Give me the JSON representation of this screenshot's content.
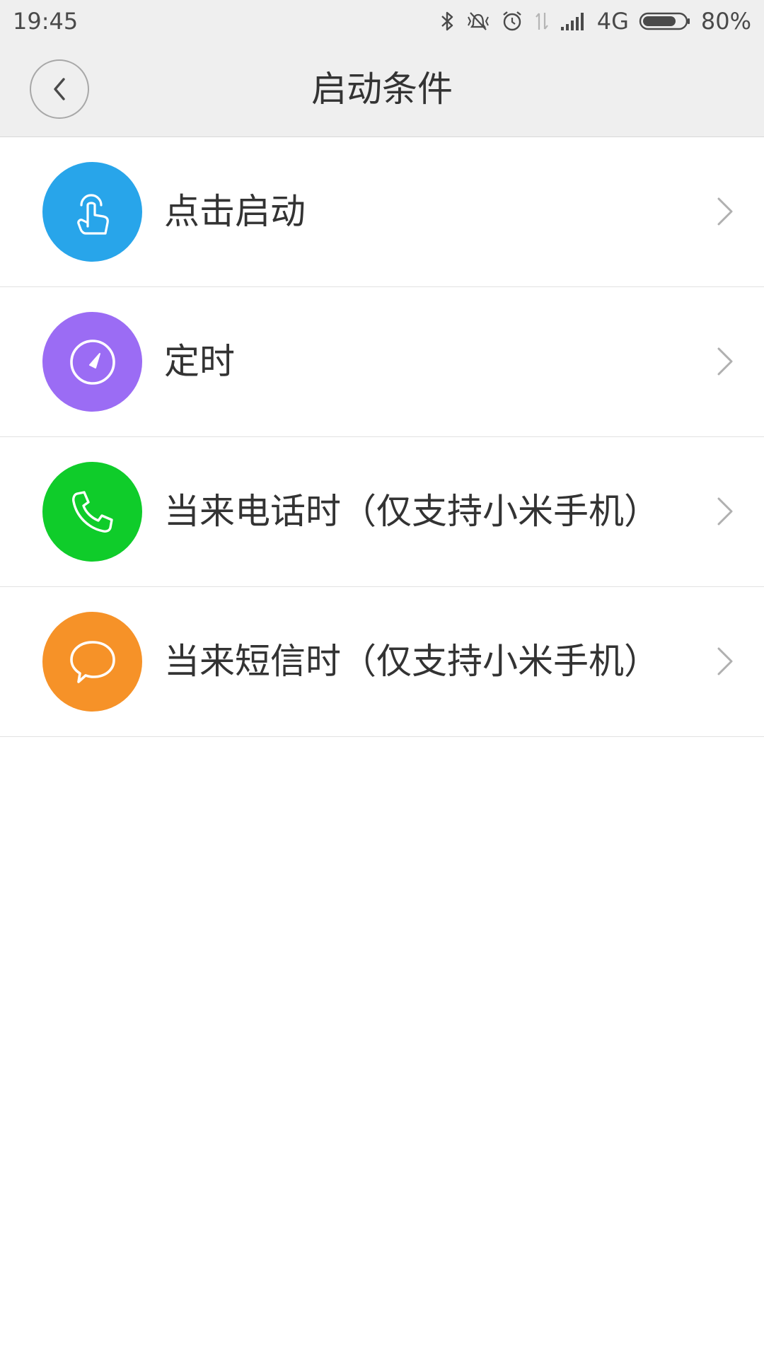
{
  "status_bar": {
    "time": "19:45",
    "network": "4G",
    "battery": "80%",
    "battery_level": 0.8,
    "icons": [
      "bluetooth-icon",
      "vibrate-off-icon",
      "alarm-icon",
      "data-arrows-icon",
      "signal-icon",
      "battery-icon"
    ]
  },
  "header": {
    "title": "启动条件",
    "back_icon": "chevron-left-icon"
  },
  "items": [
    {
      "label": "点击启动",
      "icon": "tap-finger-icon",
      "color": "#28a5ea"
    },
    {
      "label": "定时",
      "icon": "timer-icon",
      "color": "#9b6cf4"
    },
    {
      "label": "当来电话时（仅支持小米手机）",
      "icon": "phone-icon",
      "color": "#0fcc2a"
    },
    {
      "label": "当来短信时（仅支持小米手机）",
      "icon": "message-bubble-icon",
      "color": "#f69228"
    }
  ],
  "colors": {
    "header_bg": "#efefef",
    "divider": "#e2e2e2",
    "text": "#333333",
    "chevron": "#b0b0b0"
  }
}
